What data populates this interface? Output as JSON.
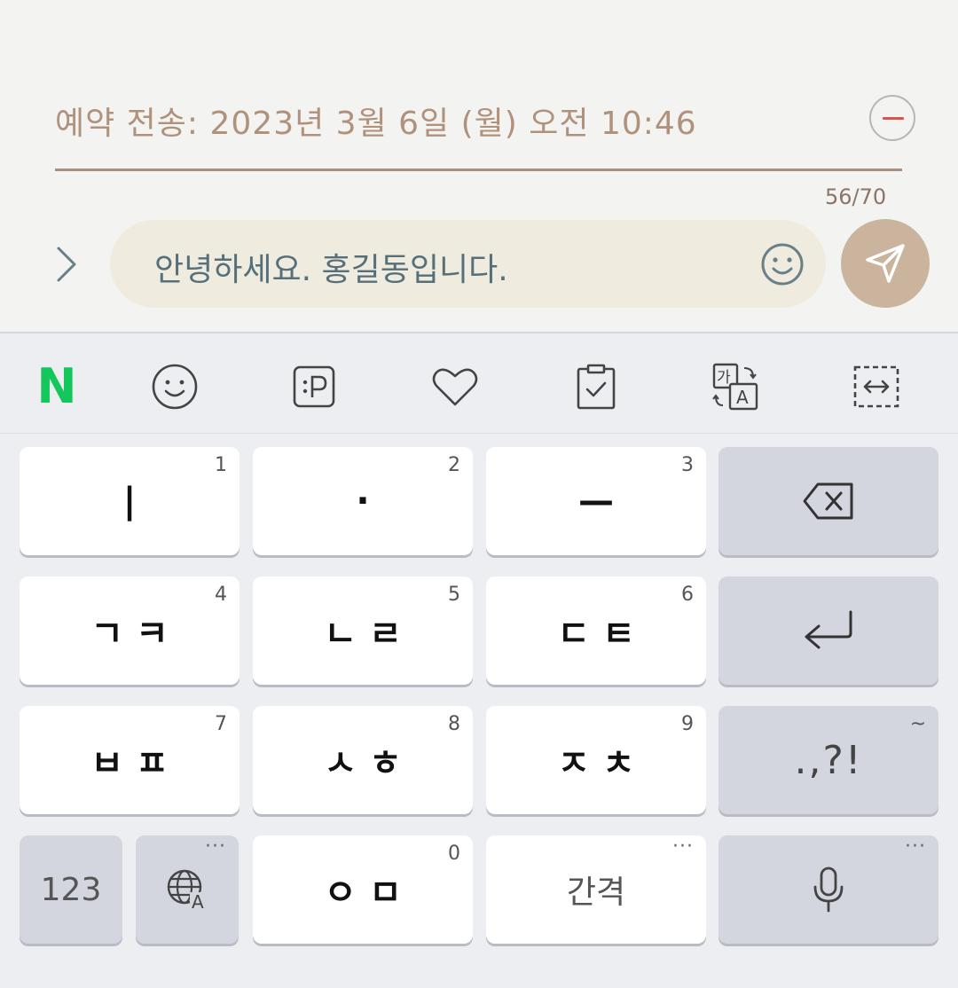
{
  "schedule": {
    "text": "예약 전송: 2023년 3월 6일 (월) 오전 10:46",
    "remove_icon": "minus-circle-icon",
    "remove_color": "#d9534f"
  },
  "composer": {
    "char_count": "56/70",
    "message": "안녕하세요. 홍길동입니다.",
    "expand_icon": "chevron-right-icon",
    "emoji_icon": "smiley-icon",
    "send_icon": "paper-plane-icon",
    "send_color": "#cab49d",
    "bubble_color": "#efebdf"
  },
  "toolbar": {
    "items": [
      "naver-n-icon",
      "emoji-icon",
      "sticker-icon",
      "heart-icon",
      "clipboard-icon",
      "translate-icon",
      "resize-icon"
    ],
    "naver_label": "N",
    "naver_color": "#13c75a"
  },
  "keyboard": {
    "row1": [
      {
        "num": "1",
        "label": "|"
      },
      {
        "num": "2",
        "label": "·"
      },
      {
        "num": "3",
        "label": "—"
      }
    ],
    "row2": [
      {
        "num": "4",
        "label": "ㄱㅋ"
      },
      {
        "num": "5",
        "label": "ㄴㄹ"
      },
      {
        "num": "6",
        "label": "ㄷㅌ"
      }
    ],
    "row3": [
      {
        "num": "7",
        "label": "ㅂㅍ"
      },
      {
        "num": "8",
        "label": "ㅅㅎ"
      },
      {
        "num": "9",
        "label": "ㅈㅊ"
      }
    ],
    "row4": {
      "numbers": "123",
      "zero": {
        "num": "0",
        "label": "ㅇㅁ"
      },
      "space": "간격",
      "more": "···"
    },
    "punct": ".,?!",
    "punct_hint": "~",
    "backspace_icon": "backspace-icon",
    "enter_icon": "enter-icon",
    "globe_icon": "globe-icon",
    "mic_icon": "mic-icon"
  }
}
